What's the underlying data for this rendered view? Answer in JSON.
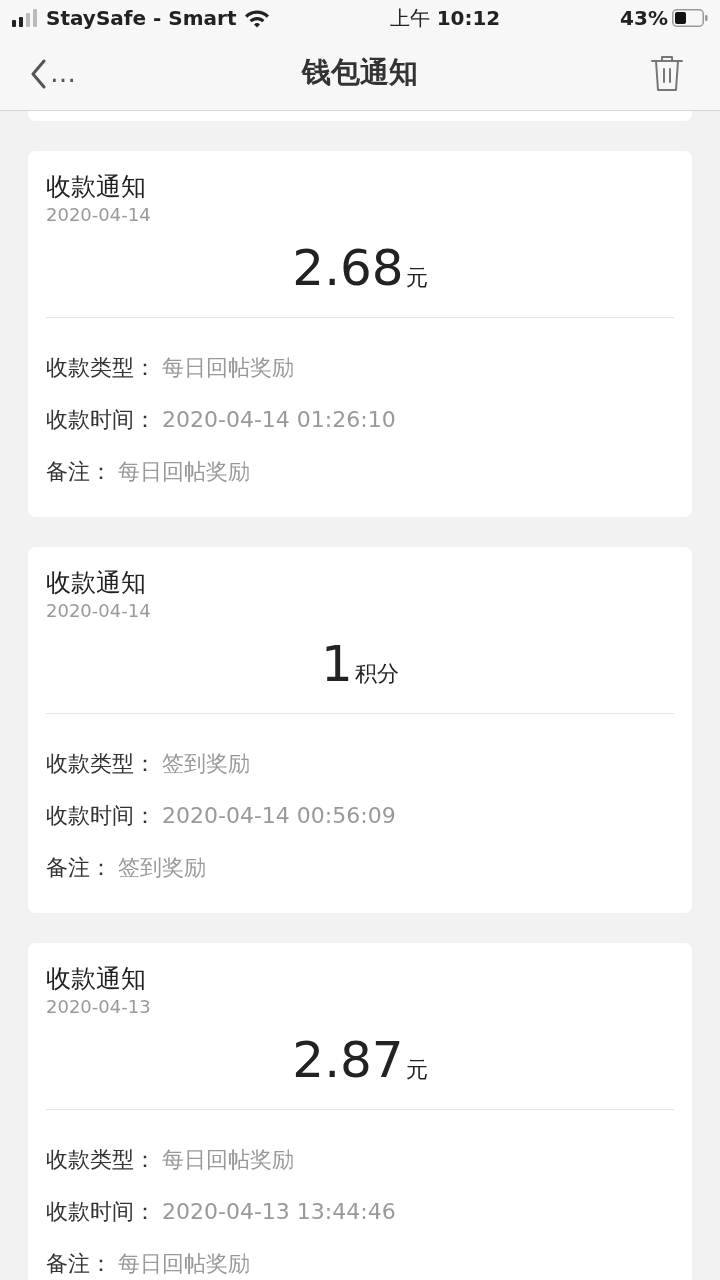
{
  "status_bar": {
    "carrier": "StaySafe - Smart",
    "time": "上午 **10:12**",
    "battery": "43%"
  },
  "nav": {
    "back_label": "…",
    "title": "钱包通知"
  },
  "notices": [
    {
      "title": "收款通知",
      "date": "2020-04-14",
      "amount": "2.68",
      "unit": "元",
      "fields": [
        {
          "label": "收款类型：",
          "value": "每日回帖奖励"
        },
        {
          "label": "收款时间：",
          "value": "2020-04-14 01:26:10"
        },
        {
          "label": "备注：",
          "value": "每日回帖奖励"
        }
      ]
    },
    {
      "title": "收款通知",
      "date": "2020-04-14",
      "amount": "1",
      "unit": "积分",
      "fields": [
        {
          "label": "收款类型：",
          "value": "签到奖励"
        },
        {
          "label": "收款时间：",
          "value": "2020-04-14 00:56:09"
        },
        {
          "label": "备注：",
          "value": "签到奖励"
        }
      ]
    },
    {
      "title": "收款通知",
      "date": "2020-04-13",
      "amount": "2.87",
      "unit": "元",
      "fields": [
        {
          "label": "收款类型：",
          "value": "每日回帖奖励"
        },
        {
          "label": "收款时间：",
          "value": "2020-04-13 13:44:46"
        },
        {
          "label": "备注：",
          "value": "每日回帖奖励"
        }
      ]
    }
  ]
}
